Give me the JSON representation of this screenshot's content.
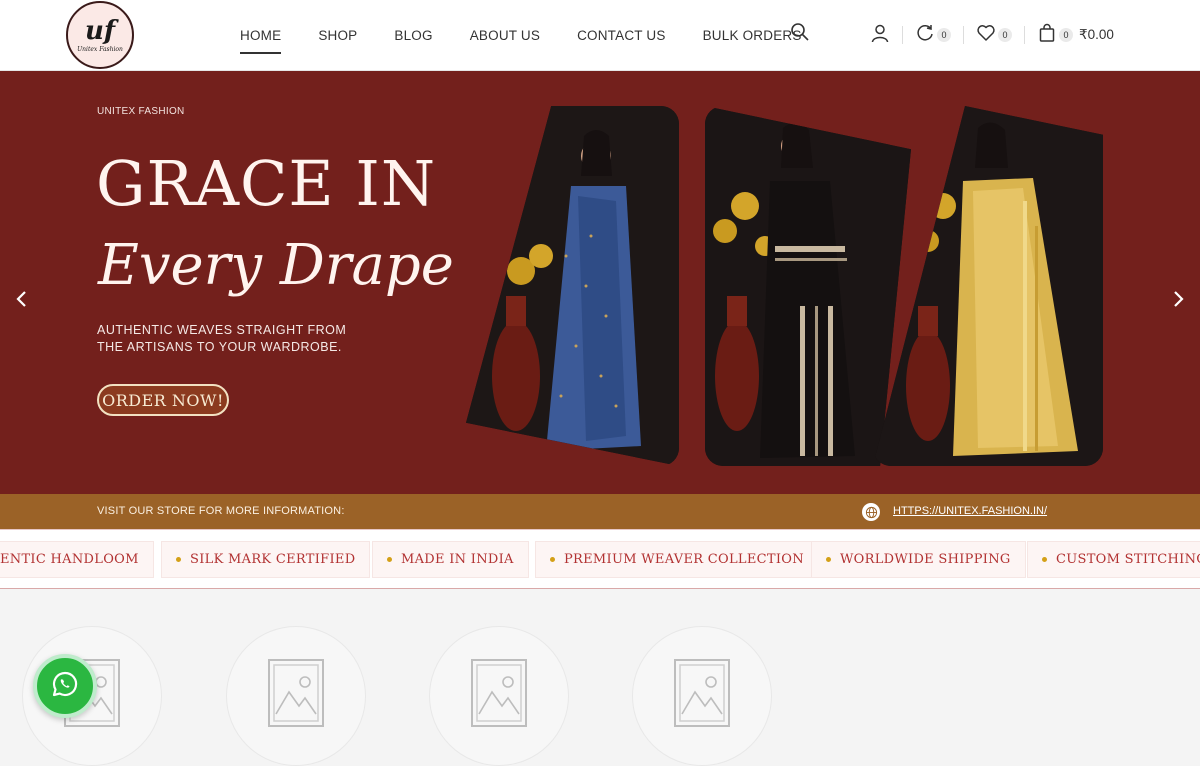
{
  "header": {
    "logo_mark": "uf",
    "logo_text": "Unitex Fashion",
    "nav": [
      "HOME",
      "SHOP",
      "BLOG",
      "ABOUT US",
      "CONTACT US",
      "BULK ORDERS"
    ],
    "active_nav": "HOME",
    "compare_count": "0",
    "wishlist_count": "0",
    "cart_count": "0",
    "cart_total": "₹0.00"
  },
  "hero": {
    "brand": "UNITEX FASHION",
    "headline": "GRACE IN",
    "script_line": "Every Drape",
    "description": "AUTHENTIC WEAVES STRAIGHT FROM THE ARTISANS TO YOUR WARDROBE.",
    "cta": "ORDER NOW!"
  },
  "strip": {
    "text": "VISIT OUR STORE FOR MORE INFORMATION:",
    "link": "HTTPS://UNITEX.FASHION.IN/"
  },
  "marquee": {
    "items": [
      "ENTIC HANDLOOM",
      "SILK MARK CERTIFIED",
      "MADE IN INDIA",
      "PREMIUM WEAVER COLLECTION",
      "WORLDWIDE SHIPPING",
      "CUSTOM STITCHING A"
    ]
  },
  "colors": {
    "hero_bg": "#73201c",
    "strip_bg": "#9b6227",
    "accent_text": "#b23232",
    "whatsapp": "#2bb741"
  },
  "icons": [
    "search-icon",
    "user-icon",
    "compare-icon",
    "heart-icon",
    "cart-icon",
    "chevron-left-icon",
    "chevron-right-icon",
    "globe-icon",
    "whatsapp-icon",
    "image-placeholder-icon"
  ]
}
